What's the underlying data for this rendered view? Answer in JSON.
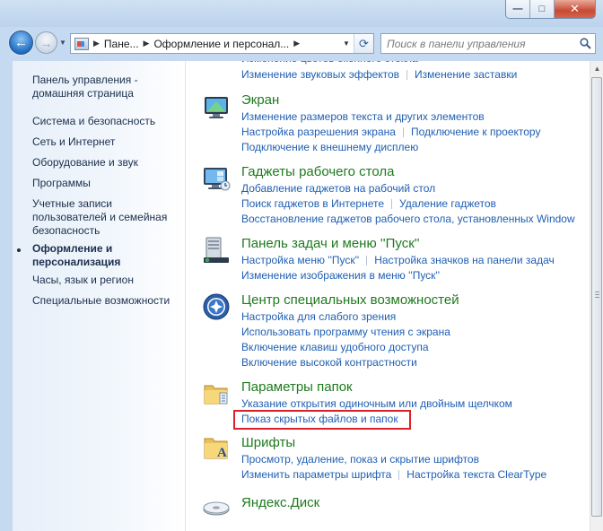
{
  "window": {
    "minimize_glyph": "—",
    "maximize_glyph": "□",
    "close_glyph": "✕"
  },
  "nav": {
    "back_glyph": "←",
    "forward_glyph": "→",
    "recent_glyph": "▼",
    "breadcrumbs": [
      "Пане...",
      "Оформление и персонал..."
    ],
    "crumb_separator": "▶",
    "dropdown_glyph": "▼",
    "refresh_glyph": "⟳",
    "search_placeholder": "Поиск в панели управления"
  },
  "sidebar": {
    "home": "Панель управления - домашняя страница",
    "items": [
      "Система и безопасность",
      "Сеть и Интернет",
      "Оборудование и звук",
      "Программы",
      "Учетные записи пользователей и семейная безопасность",
      "Оформление и персонализация",
      "Часы, язык и регион",
      "Специальные возможности"
    ],
    "current_index": 5
  },
  "categories": [
    {
      "title": "",
      "links": [
        [
          "Изменение звуковых эффектов",
          "Изменение заставки"
        ]
      ]
    },
    {
      "title": "Экран",
      "icon": "display-icon",
      "links": [
        [
          "Изменение размеров текста и других элементов"
        ],
        [
          "Настройка разрешения экрана",
          "Подключение к проектору"
        ],
        [
          "Подключение к внешнему дисплею"
        ]
      ]
    },
    {
      "title": "Гаджеты рабочего стола",
      "icon": "gadgets-icon",
      "links": [
        [
          "Добавление гаджетов на рабочий стол"
        ],
        [
          "Поиск гаджетов в Интернете",
          "Удаление гаджетов"
        ],
        [
          "Восстановление гаджетов рабочего стола, установленных Window"
        ]
      ]
    },
    {
      "title": "Панель задач и меню ''Пуск''",
      "icon": "taskbar-icon",
      "links": [
        [
          "Настройка меню ''Пуск''",
          "Настройка значков на панели задач"
        ],
        [
          "Изменение изображения в меню ''Пуск''"
        ]
      ]
    },
    {
      "title": "Центр специальных возможностей",
      "icon": "ease-of-access-icon",
      "links": [
        [
          "Настройка для слабого зрения"
        ],
        [
          "Использовать программу чтения с экрана"
        ],
        [
          "Включение клавиш удобного доступа"
        ],
        [
          "Включение высокой контрастности"
        ]
      ]
    },
    {
      "title": "Параметры папок",
      "icon": "folder-options-icon",
      "links": [
        [
          "Указание открытия одиночным или двойным щелчком"
        ],
        [
          "Показ скрытых файлов и папок"
        ]
      ]
    },
    {
      "title": "Шрифты",
      "icon": "fonts-icon",
      "links": [
        [
          "Просмотр, удаление, показ и скрытие шрифтов"
        ],
        [
          "Изменить параметры шрифта",
          "Настройка текста ClearType"
        ]
      ]
    },
    {
      "title": "Яндекс.Диск",
      "icon": "yandex-disk-icon",
      "links": []
    }
  ],
  "colors": {
    "link": "#1f5fb3",
    "category_title": "#1e7a1e",
    "highlight": "#d9222a"
  }
}
